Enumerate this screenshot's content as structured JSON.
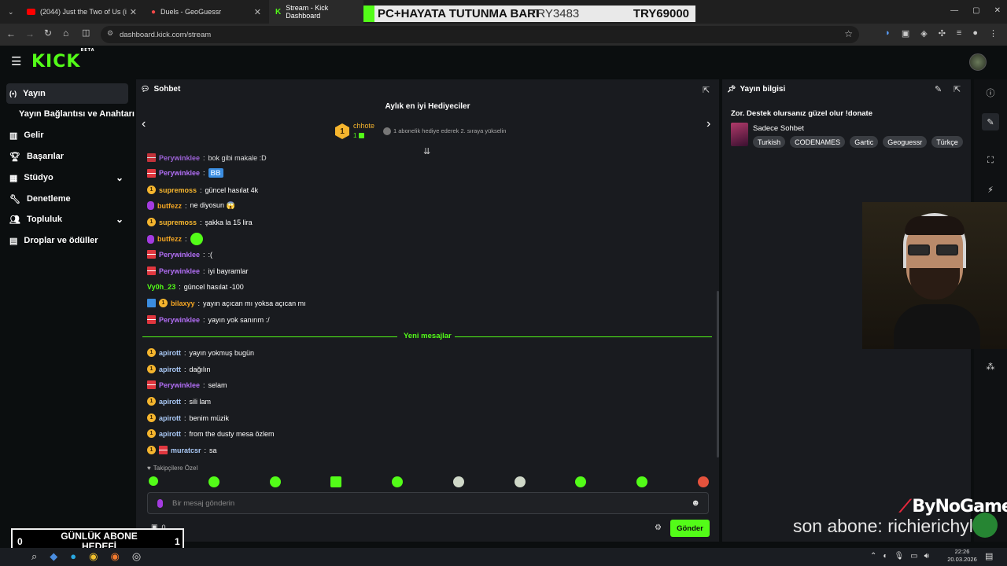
{
  "browser": {
    "tabs": [
      {
        "title": "(2044) Just the Two of Us (i"
      },
      {
        "title": "Duels - GeoGuessr"
      },
      {
        "title": "Stream - Kick Dashboard"
      }
    ],
    "url": "dashboard.kick.com/stream"
  },
  "overlay_bar": {
    "label": "PC+HAYATA TUTUNMA BARI",
    "current": "TRY3483",
    "goal": "TRY69000"
  },
  "sidebar": {
    "items": [
      {
        "label": "Yayın"
      },
      {
        "label": "Yayın Bağlantısı ve Anahtarı"
      },
      {
        "label": "Gelir"
      },
      {
        "label": "Başarılar"
      },
      {
        "label": "Stüdyo"
      },
      {
        "label": "Denetleme"
      },
      {
        "label": "Topluluk"
      },
      {
        "label": "Droplar ve ödüller"
      }
    ]
  },
  "chat": {
    "title": "Sohbet",
    "gifters_title": "Aylık en iyi Hediyeciler",
    "top_gifter": {
      "rank": "1",
      "name": "chhote",
      "count": "1"
    },
    "gifter_hint": "1 abonelik hediye ederek 2. sıraya yükselin",
    "messages": [
      {
        "user": "Perywinklee",
        "text": "bok gibi makale :D"
      },
      {
        "user": "Perywinklee",
        "text": "BB"
      },
      {
        "user": "supremoss",
        "text": "güncel hasılat 4k"
      },
      {
        "user": "butfezz",
        "text": "ne diyosun 😱"
      },
      {
        "user": "supremoss",
        "text": "şakka la 15 lira"
      },
      {
        "user": "butfezz",
        "text": ""
      },
      {
        "user": "Perywinklee",
        "text": ":("
      },
      {
        "user": "Perywinklee",
        "text": "iyi bayramlar"
      },
      {
        "user": "Vy0h_23",
        "text": "güncel hasılat -100"
      },
      {
        "user": "bilaxyy",
        "text": "yayın açıcan mı yoksa açıcan mı"
      },
      {
        "user": "Perywinklee",
        "text": "yayın yok sanırım :/"
      },
      {
        "user": "apirott",
        "text": "yayın yokmuş bugün"
      },
      {
        "user": "apirott",
        "text": "dağılın"
      },
      {
        "user": "Perywinklee",
        "text": "selam"
      },
      {
        "user": "apirott",
        "text": "sili lam"
      },
      {
        "user": "apirott",
        "text": "benim müzik"
      },
      {
        "user": "apirott",
        "text": "from the dusty mesa özlem"
      },
      {
        "user": "muratcsr",
        "text": "sa"
      }
    ],
    "new_messages_label": "Yeni mesajlar",
    "emote_label": "Takipçilere Özel",
    "input_placeholder": "Bir mesaj gönderin",
    "points": "0",
    "send_label": "Gönder"
  },
  "stream_info": {
    "title": "Yayın bilgisi",
    "stream_title": "Zor. Destek olursanız güzel olur !donate",
    "category": "Sadece Sohbet",
    "tags": [
      "Turkish",
      "CODENAMES",
      "Gartic",
      "Geoguessr",
      "Türkçe"
    ]
  },
  "overlays": {
    "daily_goal_label": "GÜNLÜK ABONE HEDEFİ",
    "daily_goal_current": "0",
    "daily_goal_target": "1",
    "last_sub": "son abone: richierichyl",
    "brand": "ByNoGame"
  },
  "taskbar": {
    "time": "22:26",
    "date": "20.03.2026"
  },
  "colors": {
    "accent": "#53fc18",
    "panel": "#191b1f",
    "background": "#0b0e0f"
  }
}
